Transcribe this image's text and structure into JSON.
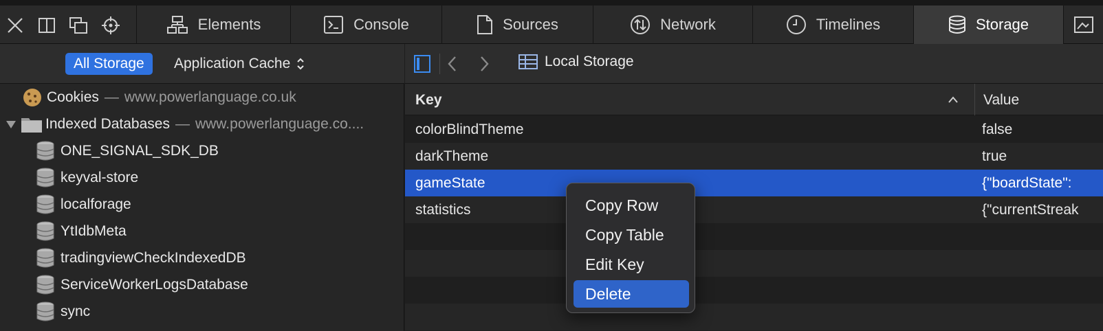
{
  "tabs": [
    {
      "label": "Elements",
      "icon": "elements-icon"
    },
    {
      "label": "Console",
      "icon": "console-icon"
    },
    {
      "label": "Sources",
      "icon": "sources-icon"
    },
    {
      "label": "Network",
      "icon": "network-icon"
    },
    {
      "label": "Timelines",
      "icon": "timelines-icon"
    },
    {
      "label": "Storage",
      "icon": "storage-icon",
      "active": true
    }
  ],
  "sidebar": {
    "filter_active": "All Storage",
    "filter_other": "Application Cache",
    "cookies": {
      "label": "Cookies",
      "domain": "www.powerlanguage.co.uk"
    },
    "indexed": {
      "label": "Indexed Databases",
      "domain": "www.powerlanguage.co...."
    },
    "databases": [
      "ONE_SIGNAL_SDK_DB",
      "keyval-store",
      "localforage",
      "YtIdbMeta",
      "tradingviewCheckIndexedDB",
      "ServiceWorkerLogsDatabase",
      "sync"
    ]
  },
  "main": {
    "breadcrumb": "Local Storage",
    "columns": {
      "key": "Key",
      "value": "Value"
    },
    "rows": [
      {
        "key": "colorBlindTheme",
        "value": "false"
      },
      {
        "key": "darkTheme",
        "value": "true"
      },
      {
        "key": "gameState",
        "value": "{\"boardState\":",
        "selected": true
      },
      {
        "key": "statistics",
        "value": "{\"currentStreak"
      }
    ]
  },
  "context_menu": {
    "items": [
      "Copy Row",
      "Copy Table",
      "Edit Key",
      "Delete"
    ],
    "highlighted": "Delete"
  },
  "colors": {
    "accent": "#2f72e0",
    "selection": "#2458c8"
  }
}
